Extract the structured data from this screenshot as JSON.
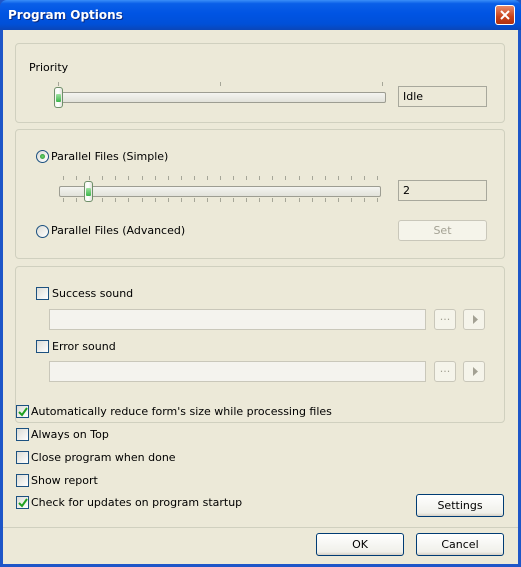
{
  "window": {
    "title": "Program Options"
  },
  "priority": {
    "label": "Priority",
    "slider_fraction": 0.0,
    "value": "Idle"
  },
  "parallel": {
    "simple_label": "Parallel Files (Simple)",
    "simple_selected": true,
    "slider_fraction": 0.08,
    "value": "2",
    "advanced_label": "Parallel Files (Advanced)",
    "set_button": "Set"
  },
  "sounds": {
    "success_label": "Success sound",
    "success_checked": false,
    "success_path": "",
    "error_label": "Error sound",
    "error_checked": false,
    "error_path": "",
    "browse_label": "...",
    "play_icon": "play-icon"
  },
  "options": [
    {
      "label": "Automatically reduce form's size while processing files",
      "checked": true
    },
    {
      "label": "Always on Top",
      "checked": false
    },
    {
      "label": "Close program when done",
      "checked": false
    },
    {
      "label": "Show report",
      "checked": false
    },
    {
      "label": "Check for updates on program startup",
      "checked": true
    }
  ],
  "buttons": {
    "settings": "Settings",
    "ok": "OK",
    "cancel": "Cancel"
  },
  "colors": {
    "titlebar": "#0054e3",
    "dialog_bg": "#ece9d8",
    "check_green": "#21a121"
  }
}
